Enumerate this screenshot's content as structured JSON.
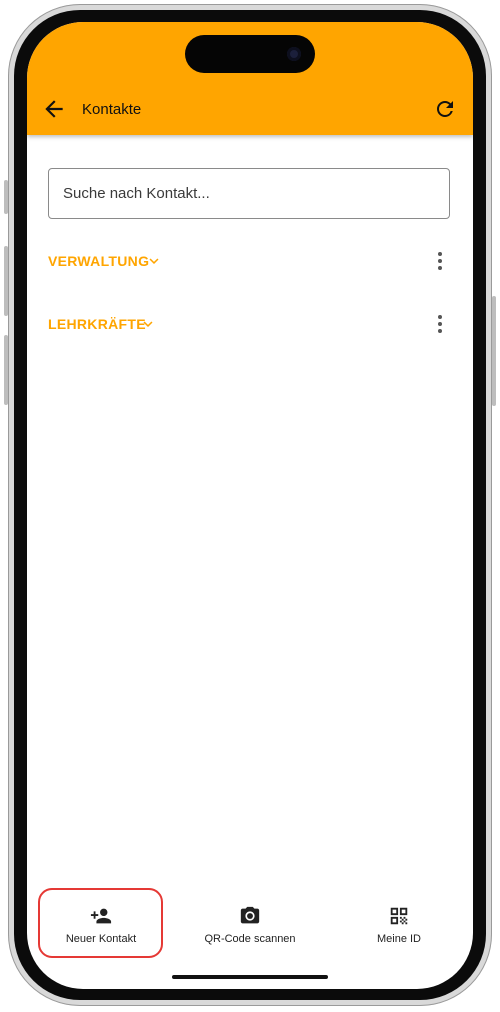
{
  "colors": {
    "accent": "#FFA500",
    "highlight": "#e53935"
  },
  "header": {
    "title": "Kontakte",
    "back_icon": "arrow-back-icon",
    "refresh_icon": "refresh-icon"
  },
  "search": {
    "placeholder": "Suche nach Kontakt...",
    "value": ""
  },
  "groups": [
    {
      "label": "VERWALTUNG",
      "icon": "chevron-down-icon",
      "menu_icon": "more-vert-icon"
    },
    {
      "label": "LEHRKRÄFTE",
      "icon": "chevron-down-icon",
      "menu_icon": "more-vert-icon"
    }
  ],
  "bottom_nav": [
    {
      "label": "Neuer Kontakt",
      "icon": "person-add-icon"
    },
    {
      "label": "QR-Code scannen",
      "icon": "camera-icon"
    },
    {
      "label": "Meine ID",
      "icon": "qr-code-icon"
    }
  ]
}
